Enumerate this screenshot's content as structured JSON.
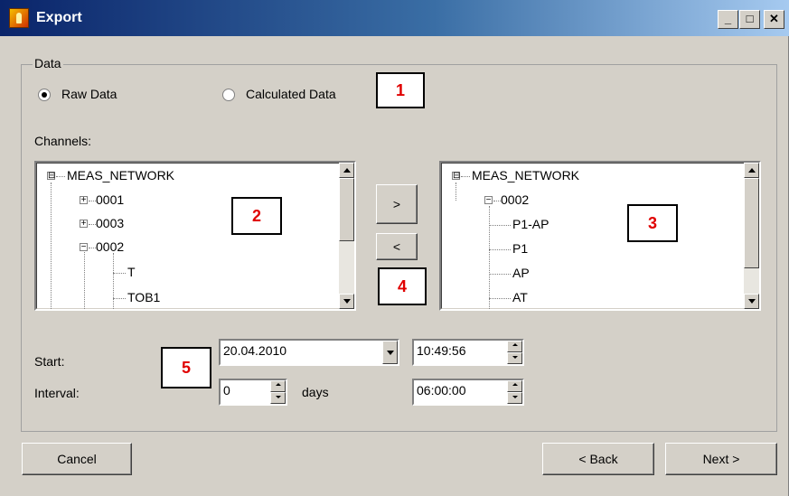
{
  "window": {
    "title": "Export",
    "minimize_glyph": "_",
    "maximize_glyph": "□",
    "close_glyph": "✕"
  },
  "data_group": {
    "label": "Data",
    "options": [
      {
        "label": "Raw Data",
        "selected": true
      },
      {
        "label": "Calculated Data",
        "selected": false
      }
    ]
  },
  "channels": {
    "label": "Channels:",
    "source_tree": [
      {
        "text": "MEAS_NETWORK",
        "expander": "⊟"
      },
      {
        "text": "0001",
        "expander": "+"
      },
      {
        "text": "0003",
        "expander": "+"
      },
      {
        "text": "0002",
        "expander": "−"
      },
      {
        "text": "T"
      },
      {
        "text": "TOB1"
      }
    ],
    "target_tree": [
      {
        "text": "MEAS_NETWORK",
        "expander": "⊟"
      },
      {
        "text": "0002",
        "expander": "−"
      },
      {
        "text": "P1-AP"
      },
      {
        "text": "P1"
      },
      {
        "text": "AP"
      },
      {
        "text": "AT"
      }
    ],
    "add_button": ">",
    "remove_button": "<"
  },
  "time": {
    "start_label": "Start:",
    "start_date": "20.04.2010",
    "start_time": "10:49:56",
    "interval_label": "Interval:",
    "interval_days": "0",
    "days_unit": "days",
    "interval_time": "06:00:00"
  },
  "footer": {
    "cancel": "Cancel",
    "back": "< Back",
    "next": "Next >"
  },
  "callouts": [
    "1",
    "2",
    "3",
    "4",
    "5"
  ],
  "colors": {
    "callout_text": "#e00000",
    "titlebar_start": "#0a246a",
    "titlebar_end": "#a6caf0",
    "dialog_bg": "#d4d0c8"
  }
}
